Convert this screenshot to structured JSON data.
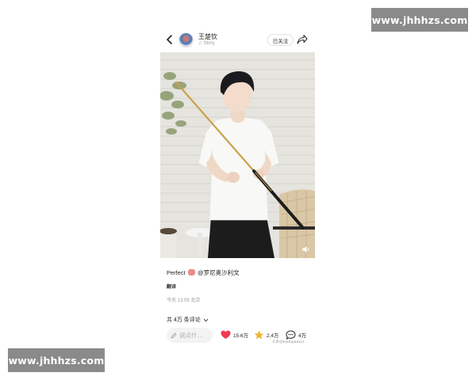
{
  "watermark": {
    "top_text": "www.jhhhzs.com",
    "bottom_text": "www.jhhhzs.com"
  },
  "header": {
    "username": "王楚钦",
    "subtitle": "Story",
    "follow_label": "已关注",
    "back_icon": "chevron-left-icon",
    "share_icon": "share-arrow-icon"
  },
  "post": {
    "caption_text": "Perfect",
    "caption_mention": "@罗尼奥沙利文",
    "translate_label": "翻译",
    "timestamp": "今天 13:09 北京",
    "comment_count_label": "共 4万 条评论"
  },
  "bottom_bar": {
    "input_placeholder": "说点什…",
    "likes": "15.6万",
    "favorites": "2.4万",
    "comments": "4万",
    "source_watermark": "头条@Eurkop&5114"
  },
  "colors": {
    "like": "#f03a52",
    "favorite": "#f2b531",
    "accent": "#222222"
  }
}
